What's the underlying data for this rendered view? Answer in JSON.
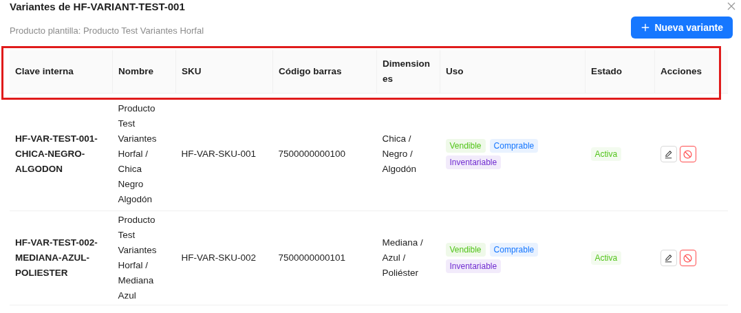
{
  "dialog": {
    "title": "Variantes de HF-VARIANT-TEST-001",
    "subtitle": "Producto plantilla: Producto Test Variantes Horfal",
    "new_button": "Nueva variante"
  },
  "annotation": {
    "header_highlighted": true
  },
  "table": {
    "columns": [
      "Clave interna",
      "Nombre",
      "SKU",
      "Código barras",
      "Dimensiones",
      "Uso",
      "Estado",
      "Acciones"
    ],
    "rows": [
      {
        "key": "HF-VAR-TEST-001-CHICA-NEGRO-ALGODON",
        "name": "Producto Test Variantes Horfal / Chica Negro Algodón",
        "sku": "HF-VAR-SKU-001",
        "barcode": "7500000000100",
        "dimensions": "Chica / Negro / Algodón",
        "uses": [
          {
            "label": "Vendible",
            "color": "#52c41a"
          },
          {
            "label": "Comprable",
            "color": "#1677ff"
          },
          {
            "label": "Inventariable",
            "color": "#722ed1"
          }
        ],
        "status": {
          "label": "Activa",
          "color": "#52c41a"
        },
        "actions": [
          {
            "kind": "edit"
          },
          {
            "kind": "disable"
          }
        ]
      },
      {
        "key": "HF-VAR-TEST-002-MEDIANA-AZUL-POLIESTER",
        "name": "Producto Test Variantes Horfal / Mediana Azul",
        "sku": "HF-VAR-SKU-002",
        "barcode": "7500000000101",
        "dimensions": "Mediana / Azul / Poliéster",
        "uses": [
          {
            "label": "Vendible",
            "color": "#52c41a"
          },
          {
            "label": "Comprable",
            "color": "#1677ff"
          },
          {
            "label": "Inventariable",
            "color": "#722ed1"
          }
        ],
        "status": {
          "label": "Activa",
          "color": "#52c41a"
        },
        "actions": [
          {
            "kind": "edit"
          },
          {
            "kind": "disable"
          }
        ]
      }
    ]
  }
}
